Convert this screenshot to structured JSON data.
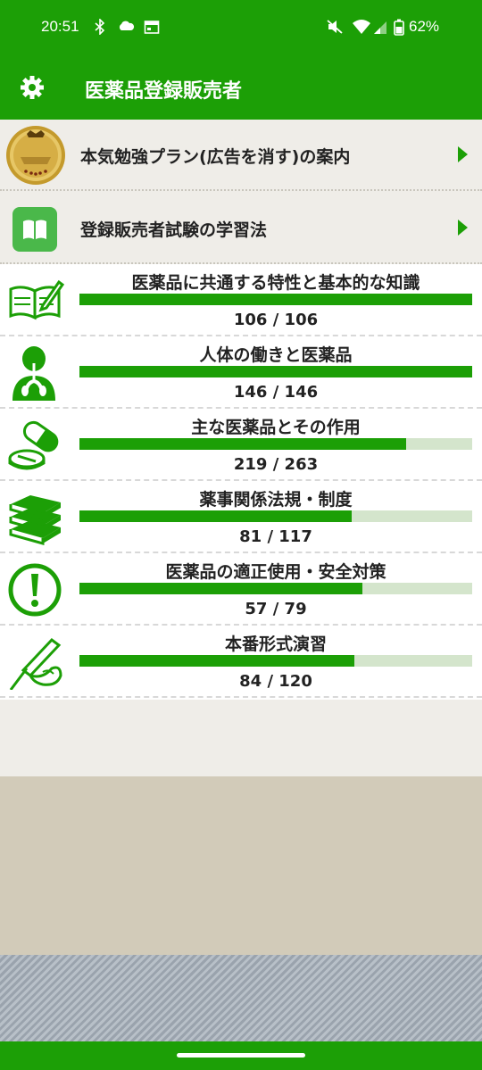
{
  "status_bar": {
    "time": "20:51",
    "battery": "62%",
    "icons": [
      "bluetooth-icon",
      "cloud-icon",
      "calendar-icon",
      "mute-icon",
      "wifi-icon",
      "signal-icon",
      "battery-icon"
    ]
  },
  "app_bar": {
    "title": "医薬品登録販売者",
    "settings_icon": "gear-icon"
  },
  "menu": [
    {
      "label": "本気勉強プラン(広告を消す)の案内",
      "icon": "premium-medal-icon"
    },
    {
      "label": "登録販売者試験の学習法",
      "icon": "book-icon"
    }
  ],
  "categories": [
    {
      "title": "医薬品に共通する特性と基本的な知識",
      "count": "106 / 106",
      "done": 106,
      "total": 106,
      "icon": "notebook-pen-icon"
    },
    {
      "title": "人体の働きと医薬品",
      "count": "146 / 146",
      "done": 146,
      "total": 146,
      "icon": "human-body-icon"
    },
    {
      "title": "主な医薬品とその作用",
      "count": "219 / 263",
      "done": 219,
      "total": 263,
      "icon": "pills-icon"
    },
    {
      "title": "薬事関係法規・制度",
      "count": "81 / 117",
      "done": 81,
      "total": 117,
      "icon": "book-stack-icon"
    },
    {
      "title": "医薬品の適正使用・安全対策",
      "count": "57 / 79",
      "done": 57,
      "total": 79,
      "icon": "exclamation-icon"
    },
    {
      "title": "本番形式演習",
      "count": "84 / 120",
      "done": 84,
      "total": 120,
      "icon": "hand-writing-icon"
    }
  ],
  "colors": {
    "primary_green": "#1c9f06",
    "bar_track": "#d4e5cc",
    "background": "#efede8",
    "footer_tan": "#d2cbb9"
  }
}
